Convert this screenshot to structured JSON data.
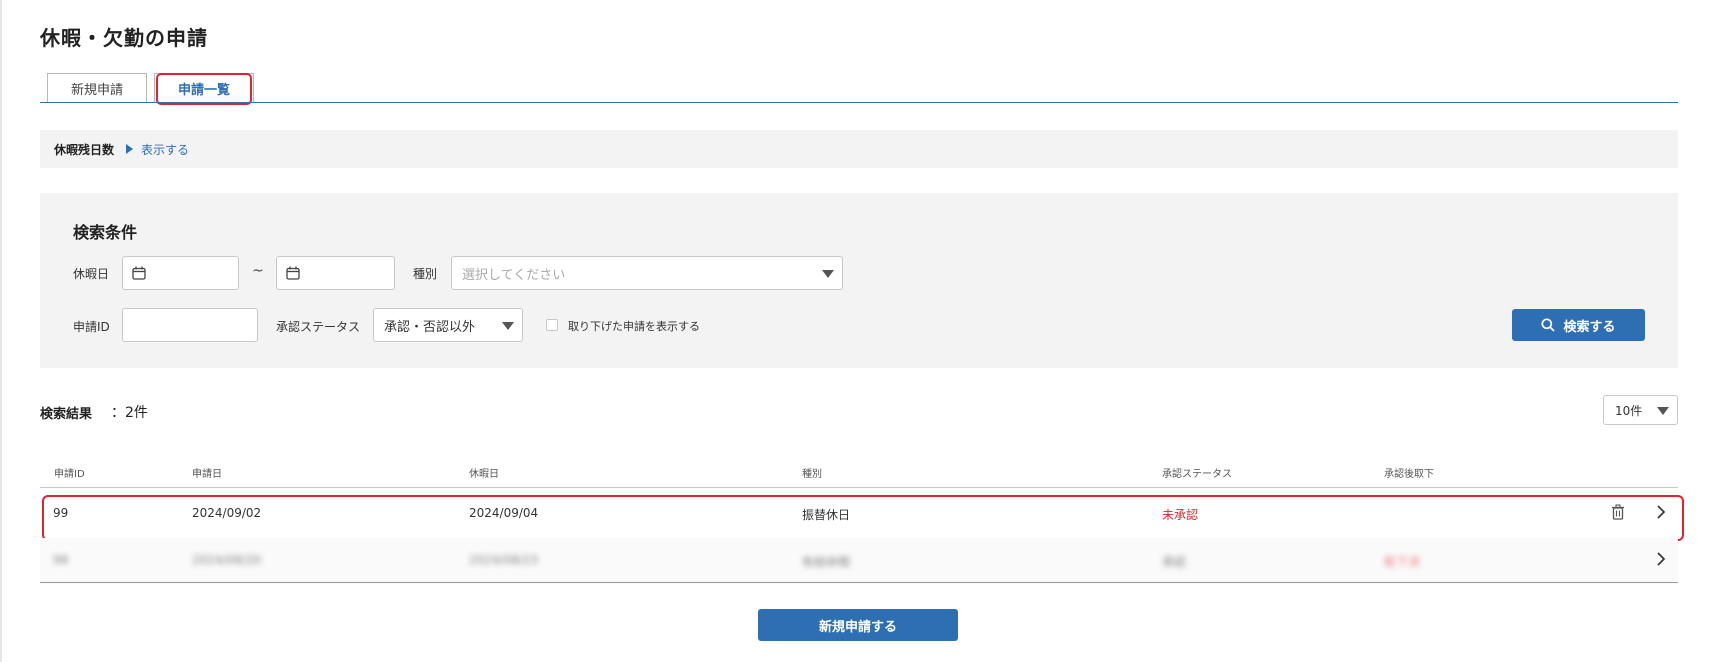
{
  "page": {
    "title": "休暇・欠勤の申請"
  },
  "tabs": [
    {
      "label": "新規申請",
      "active": false
    },
    {
      "label": "申請一覧",
      "active": true
    }
  ],
  "remaining_days": {
    "label": "休暇残日数",
    "toggle_label": "表示する"
  },
  "search": {
    "title": "検索条件",
    "holiday_label": "休暇日",
    "range_separator": "~",
    "holiday_from": "",
    "holiday_to": "",
    "type_label": "種別",
    "type_placeholder": "選択してください",
    "request_id_label": "申請ID",
    "request_id_value": "",
    "status_label": "承認ステータス",
    "status_value": "承認・否認以外",
    "show_withdrawn_label": "取り下げた申請を表示する",
    "show_withdrawn_checked": false,
    "search_button_label": "検索する"
  },
  "results": {
    "label": "検索結果",
    "count_text": "：2件",
    "per_page": "10件",
    "columns": [
      "申請ID",
      "申請日",
      "休暇日",
      "種別",
      "承認ステータス",
      "承認後取下"
    ],
    "rows": [
      {
        "id": "99",
        "applied": "2024/09/02",
        "holiday": "2024/09/04",
        "type": "振替休日",
        "status": "未承認",
        "withdraw": ""
      },
      {
        "id": "98",
        "applied": "2024/08/20",
        "holiday": "2024/08/23",
        "type": "有給休暇",
        "status": "承認",
        "withdraw": "取下済"
      }
    ]
  },
  "new_request_button": "新規申請する",
  "colors": {
    "accent": "#2e6fb4",
    "danger": "#e0232f",
    "panel": "#f3f3f3"
  }
}
